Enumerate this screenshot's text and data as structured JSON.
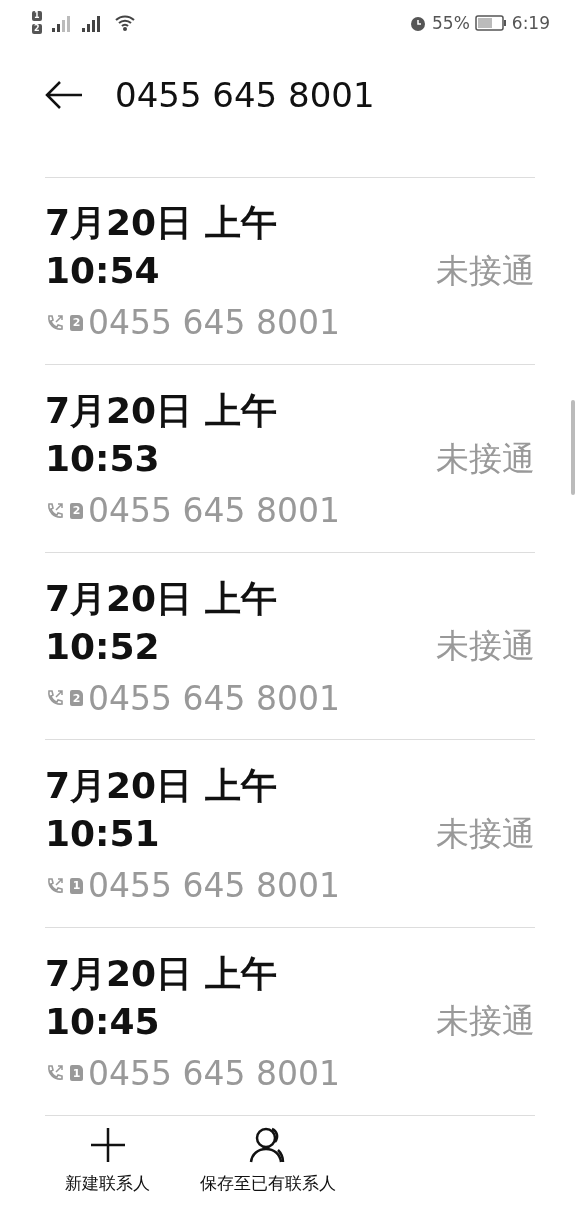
{
  "status_bar": {
    "sims": [
      "1",
      "2"
    ],
    "battery_percent": "55%",
    "time": "6:19"
  },
  "header": {
    "title": "0455 645 8001"
  },
  "calls": [
    {
      "date": "7月20日 上午",
      "time": "10:54",
      "status": "未接通",
      "sim": "2",
      "number": "0455 645 8001"
    },
    {
      "date": "7月20日 上午",
      "time": "10:53",
      "status": "未接通",
      "sim": "2",
      "number": "0455 645 8001"
    },
    {
      "date": "7月20日 上午",
      "time": "10:52",
      "status": "未接通",
      "sim": "2",
      "number": "0455 645 8001"
    },
    {
      "date": "7月20日 上午",
      "time": "10:51",
      "status": "未接通",
      "sim": "1",
      "number": "0455 645 8001"
    },
    {
      "date": "7月20日 上午",
      "time": "10:45",
      "status": "未接通",
      "sim": "1",
      "number": "0455 645 8001"
    }
  ],
  "actions": [
    {
      "kind": "add",
      "label": "新建联系人"
    },
    {
      "kind": "contact",
      "label": "保存至已有联系人"
    }
  ]
}
